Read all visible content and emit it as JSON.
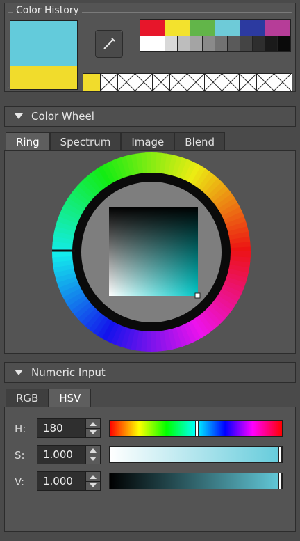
{
  "history": {
    "label": "Color History",
    "current_color": "#63cbdb",
    "previous_color": "#f1dc2c",
    "palette_row1": [
      "#e7162a",
      "#f3e22d",
      "#62b549",
      "#6ecbd8",
      "#2c3aa0",
      "#b63d98"
    ],
    "palette_row2": [
      "#ffffff",
      "#d8d8d8",
      "#bdbdbd",
      "#a4a4a4",
      "#8a8a8a",
      "#727272",
      "#5a5a5a",
      "#444444",
      "#2e2e2e",
      "#1a1a1a",
      "#0a0a0a"
    ],
    "recent": [
      "#f1dc2c",
      "empty",
      "empty",
      "empty",
      "empty",
      "empty",
      "empty",
      "empty",
      "empty",
      "empty",
      "empty",
      "empty"
    ],
    "picker_icon": "eyedropper-icon"
  },
  "wheel": {
    "title": "Color Wheel",
    "tabs": [
      "Ring",
      "Spectrum",
      "Image",
      "Blend"
    ],
    "active_tab": "Ring",
    "hue_color": "#00c8c8"
  },
  "numeric": {
    "title": "Numeric Input",
    "tabs": [
      "RGB",
      "HSV"
    ],
    "active_tab": "HSV",
    "fields": [
      {
        "label": "H:",
        "value": "180"
      },
      {
        "label": "S:",
        "value": "1.000"
      },
      {
        "label": "V:",
        "value": "1.000"
      }
    ]
  }
}
